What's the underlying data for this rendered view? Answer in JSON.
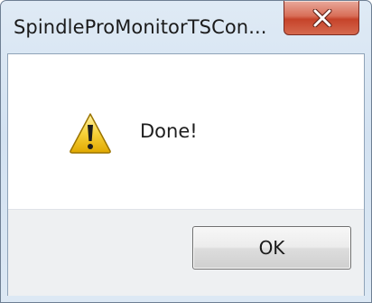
{
  "window": {
    "title": "SpindleProMonitorTSCon..."
  },
  "message": {
    "icon": "warning-icon",
    "text": "Done!"
  },
  "buttons": {
    "ok_label": "OK"
  },
  "colors": {
    "close_button": "#c6432a",
    "warning_fill": "#f5c518"
  }
}
